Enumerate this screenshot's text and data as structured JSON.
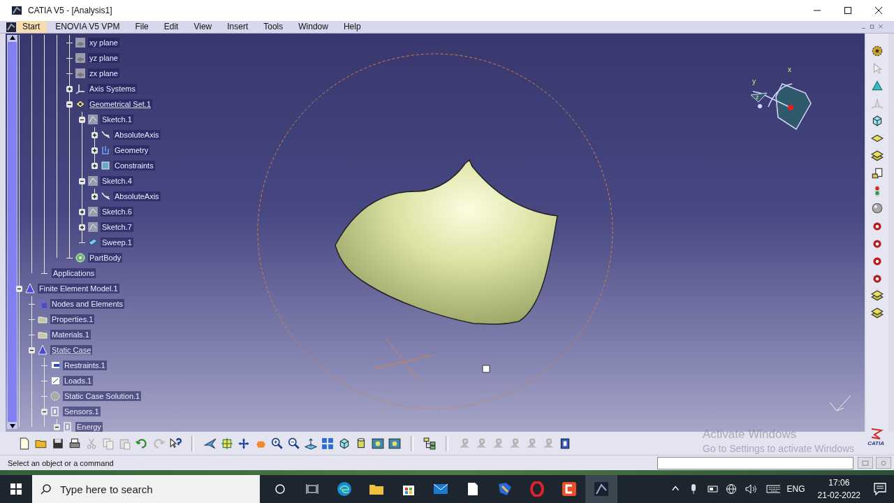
{
  "window": {
    "title": "CATIA V5 - [Analysis1]"
  },
  "menu": [
    {
      "label": "Start",
      "selected": true
    },
    {
      "label": "ENOVIA V5 VPM",
      "selected": false
    },
    {
      "label": "File",
      "selected": false
    },
    {
      "label": "Edit",
      "selected": false
    },
    {
      "label": "View",
      "selected": false
    },
    {
      "label": "Insert",
      "selected": false
    },
    {
      "label": "Tools",
      "selected": false
    },
    {
      "label": "Window",
      "selected": false
    },
    {
      "label": "Help",
      "selected": false
    }
  ],
  "tree": {
    "children": [
      {
        "children": [
          {
            "children": [
              {
                "children": [
                  {
                    "children": [
                      {
                        "label": "xy plane",
                        "kind": "plane"
                      },
                      {
                        "label": "yz plane",
                        "kind": "plane"
                      },
                      {
                        "label": "zx plane",
                        "kind": "plane"
                      },
                      {
                        "label": "Axis Systems",
                        "kind": "axis-system",
                        "expanded": false
                      },
                      {
                        "label": "Geometrical Set.1",
                        "kind": "geoset",
                        "expanded": true,
                        "current": true,
                        "children": [
                          {
                            "label": "Sketch.1",
                            "kind": "sketch",
                            "expanded": true,
                            "children": [
                              {
                                "label": "AbsoluteAxis",
                                "kind": "axis",
                                "expanded": false
                              },
                              {
                                "label": "Geometry",
                                "kind": "geometry",
                                "expanded": false
                              },
                              {
                                "label": "Constraints",
                                "kind": "constraints",
                                "expanded": false
                              }
                            ]
                          },
                          {
                            "label": "Sketch.4",
                            "kind": "sketch",
                            "expanded": true,
                            "children": [
                              {
                                "label": "AbsoluteAxis",
                                "kind": "axis",
                                "expanded": false
                              }
                            ]
                          },
                          {
                            "label": "Sketch.6",
                            "kind": "sketch",
                            "expanded": false
                          },
                          {
                            "label": "Sketch.7",
                            "kind": "sketch",
                            "expanded": false
                          },
                          {
                            "label": "Sweep.1",
                            "kind": "sweep"
                          }
                        ]
                      },
                      {
                        "label": "PartBody",
                        "kind": "body"
                      }
                    ]
                  }
                ]
              },
              {
                "label": "Applications"
              }
            ]
          }
        ]
      },
      {
        "label": "Finite Element Model.1",
        "kind": "fem",
        "expanded": true,
        "children": [
          {
            "label": "Nodes and Elements",
            "kind": "nodes"
          },
          {
            "label": "Properties.1",
            "kind": "properties"
          },
          {
            "label": "Materials.1",
            "kind": "properties"
          },
          {
            "label": "Static Case",
            "kind": "fem",
            "expanded": true,
            "current": true,
            "children": [
              {
                "label": "Restraints.1",
                "kind": "restraints"
              },
              {
                "label": "Loads.1",
                "kind": "loads"
              },
              {
                "label": "Static Case Solution.1",
                "kind": "solution"
              },
              {
                "label": "Sensors.1",
                "kind": "sensors",
                "expanded": true,
                "children": [
                  {
                    "label": "Energy",
                    "kind": "sensors",
                    "expanded": true
                  }
                ]
              }
            ]
          }
        ]
      }
    ]
  },
  "compass": {
    "labels": [
      "y",
      "x",
      "z"
    ]
  },
  "logo": {
    "text": "CATIA"
  },
  "activation_notice": {
    "title": "Activate Windows",
    "hint": "Go to Settings to activate Windows"
  },
  "status_bar": {
    "message": "Select an object or a command"
  },
  "taskbar": {
    "search": {
      "placeholder": "Type here to search"
    },
    "language": "ENG",
    "time": "17:06",
    "date": "21-02-2022"
  }
}
